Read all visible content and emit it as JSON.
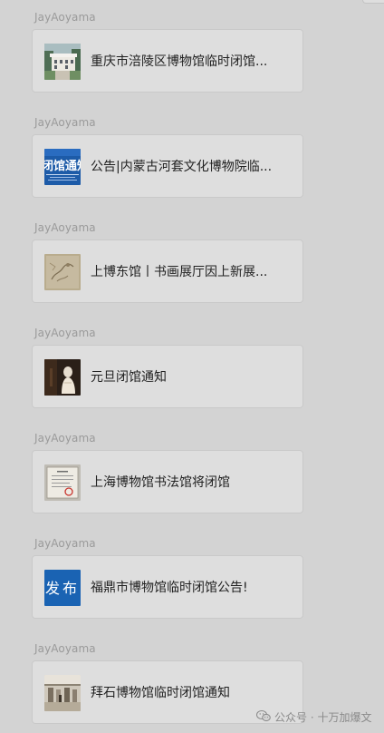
{
  "feed": {
    "items": [
      {
        "sender": "JayAoyama",
        "title": "重庆市涪陵区博物馆临时闭馆...",
        "thumb_icon": "museum-building-photo-icon"
      },
      {
        "sender": "JayAoyama",
        "title": "公告|内蒙古河套文化博物院临...",
        "thumb_icon": "notice-banner-icon",
        "thumb_text": "闭馆通知"
      },
      {
        "sender": "JayAoyama",
        "title": "上博东馆丨书画展厅因上新展...",
        "thumb_icon": "painting-scroll-icon"
      },
      {
        "sender": "JayAoyama",
        "title": "元旦闭馆通知",
        "thumb_icon": "statue-photo-icon"
      },
      {
        "sender": "JayAoyama",
        "title": "上海博物馆书法馆将闭馆",
        "thumb_icon": "certificate-document-icon"
      },
      {
        "sender": "JayAoyama",
        "title": "福鼎市博物馆临时闭馆公告!",
        "thumb_icon": "announcement-badge-icon",
        "thumb_text": "发布"
      },
      {
        "sender": "JayAoyama",
        "title": "拜石博物馆临时闭馆通知",
        "thumb_icon": "exhibition-hall-photo-icon"
      }
    ]
  },
  "watermark": {
    "text": "公众号 · 十万加爆文",
    "icon": "wechat-logo-icon"
  },
  "colors": {
    "background": "#d3d3d3",
    "card": "#dedede",
    "card_border": "#c9c9c9",
    "sender_text": "#9a9a9a",
    "title_text": "#222222",
    "notice_blue": "#1d5ba8"
  }
}
